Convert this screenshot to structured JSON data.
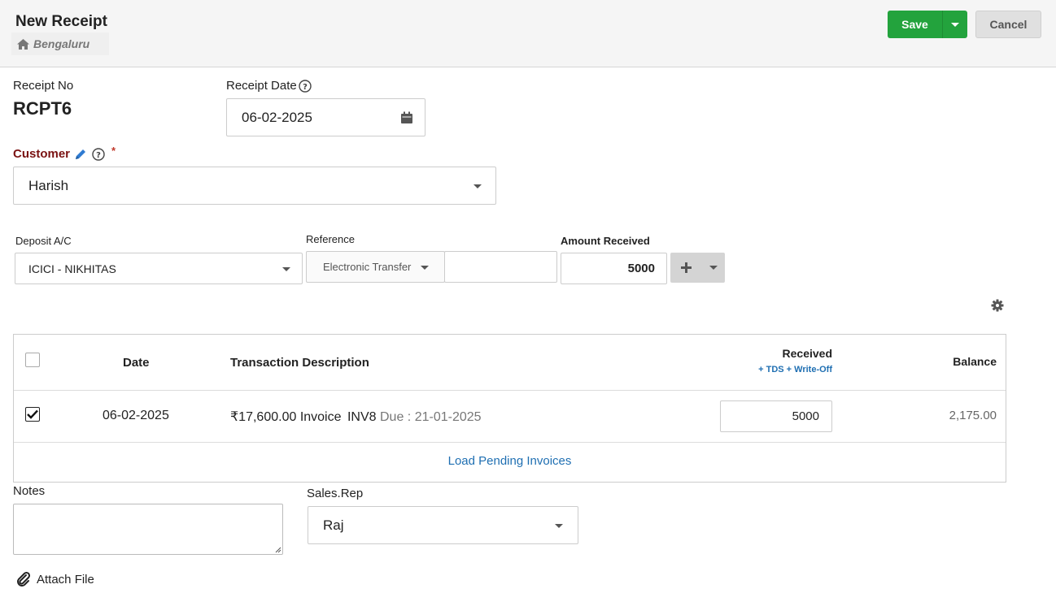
{
  "header": {
    "title": "New Receipt",
    "branch": "Bengaluru",
    "save_label": "Save",
    "cancel_label": "Cancel"
  },
  "form": {
    "receipt_no_label": "Receipt No",
    "receipt_no_value": "RCPT6",
    "receipt_date_label": "Receipt Date",
    "receipt_date_value": "06-02-2025",
    "customer_label": "Customer",
    "customer_required_mark": "*",
    "customer_value": "Harish",
    "deposit_label": "Deposit A/C",
    "deposit_value": "ICICI - NIKHITAS",
    "reference_label": "Reference",
    "reference_type": "Electronic Transfer",
    "reference_value": "",
    "amount_label": "Amount Received",
    "amount_value": "5000"
  },
  "table": {
    "headers": {
      "date": "Date",
      "description": "Transaction Description",
      "received": "Received",
      "received_sub": "+ TDS + Write-Off",
      "balance": "Balance"
    },
    "rows": [
      {
        "checked": true,
        "date": "06-02-2025",
        "amount": "₹17,600.00",
        "type": "Invoice",
        "invoice_no": "INV8",
        "due": "Due : 21-01-2025",
        "received": "5000",
        "balance": "2,175.00"
      }
    ],
    "load_pending_label": "Load Pending Invoices"
  },
  "footer": {
    "notes_label": "Notes",
    "notes_value": "",
    "sales_rep_label": "Sales.Rep",
    "sales_rep_value": "Raj",
    "attach_label": "Attach File"
  },
  "colors": {
    "save": "#23a33d",
    "customer_label": "#7a1212",
    "link": "#1f6fb2",
    "pencil_icon": "#2f7bd1"
  }
}
